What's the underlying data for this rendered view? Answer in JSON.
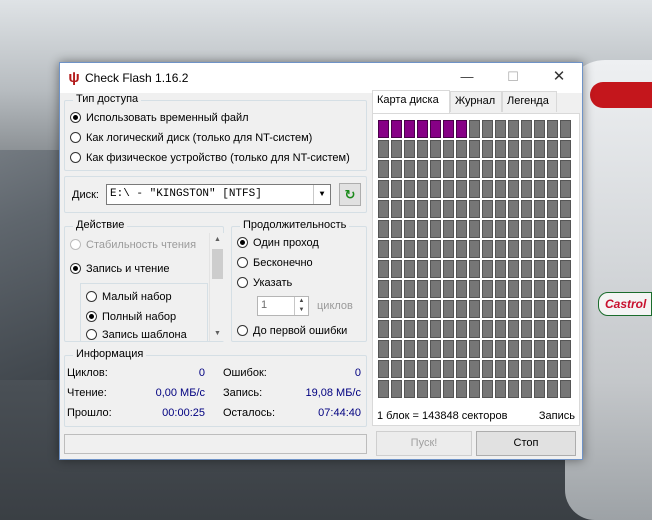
{
  "window": {
    "title": "Check Flash 1.16.2"
  },
  "access": {
    "legend": "Тип доступа",
    "options": [
      {
        "label": "Использовать временный файл",
        "checked": true
      },
      {
        "label": "Как логический диск (только для NT-систем)",
        "checked": false
      },
      {
        "label": "Как физическое устройство (только для NT-систем)",
        "checked": false
      }
    ]
  },
  "disk": {
    "label": "Диск:",
    "value": "E:\\ - \"KINGSTON\" [NTFS]"
  },
  "action": {
    "legend": "Действие",
    "options": [
      {
        "label": "Стабильность чтения",
        "checked": false,
        "disabled": true
      },
      {
        "label": "Запись и чтение",
        "checked": true,
        "disabled": false
      }
    ],
    "sub_options": [
      {
        "label": "Малый набор",
        "checked": false
      },
      {
        "label": "Полный набор",
        "checked": true
      },
      {
        "label": "Запись шаблона",
        "checked": false
      }
    ]
  },
  "duration": {
    "legend": "Продолжительность",
    "options": [
      {
        "label": "Один проход",
        "checked": true
      },
      {
        "label": "Бесконечно",
        "checked": false
      },
      {
        "label": "Указать",
        "checked": false
      }
    ],
    "cycles_value": "1",
    "cycles_label": "циклов",
    "until_error": {
      "label": "До первой ошибки",
      "checked": false
    }
  },
  "info": {
    "legend": "Информация",
    "cycles_label": "Циклов:",
    "cycles_value": "0",
    "errors_label": "Ошибок:",
    "errors_value": "0",
    "read_label": "Чтение:",
    "read_value": "0,00 МБ/с",
    "write_label": "Запись:",
    "write_value": "19,08 МБ/с",
    "elapsed_label": "Прошло:",
    "elapsed_value": "00:00:25",
    "remaining_label": "Осталось:",
    "remaining_value": "07:44:40"
  },
  "tabs": [
    "Карта диска",
    "Журнал",
    "Легенда"
  ],
  "disk_map": {
    "columns": 15,
    "rows": 14,
    "done_blocks": 7
  },
  "status": {
    "block_info": "1 блок = 143848 секторов",
    "mode": "Запись"
  },
  "buttons": {
    "start": "Пуск!",
    "stop": "Стоп"
  },
  "colors": {
    "done_block": "#870086",
    "pending_block": "#767676",
    "title_icon": "#b21a1a"
  },
  "icons": {
    "title": "check-flash-logo-icon",
    "refresh": "refresh-icon",
    "minimize": "minimize-icon",
    "maximize": "maximize-icon",
    "close": "close-icon"
  },
  "background_logo": "Castrol"
}
